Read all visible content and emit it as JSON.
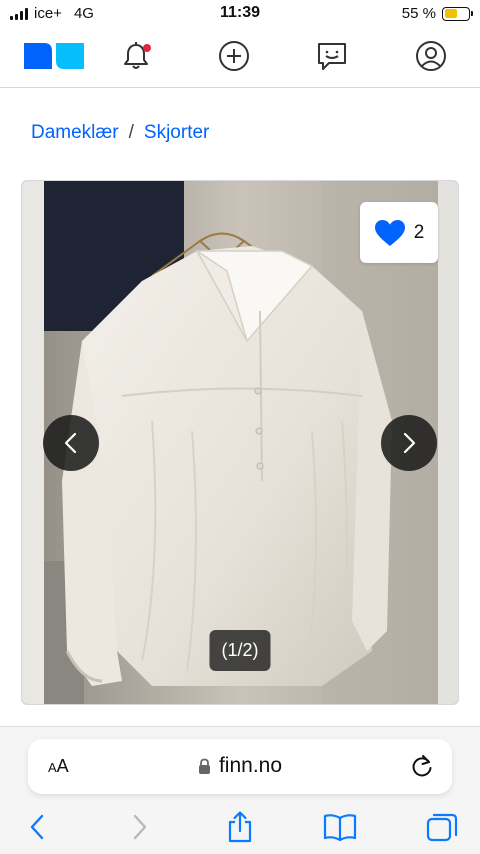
{
  "status": {
    "carrier": "ice+",
    "network": "4G",
    "time": "11:39",
    "battery_label": "55 %",
    "battery_level": 0.55
  },
  "header": {
    "logo": "finn-logo",
    "icons": [
      "bell-icon",
      "plus-circle-icon",
      "chat-icon",
      "profile-icon"
    ],
    "notification_dot_color": "#e0263a"
  },
  "breadcrumb": {
    "items": [
      "Dameklær",
      "Skjorter"
    ],
    "separator": "/"
  },
  "gallery": {
    "favorite_count": "2",
    "image_counter": "(1/2)",
    "heart_color": "#0063fb"
  },
  "browser": {
    "text_size_small": "A",
    "text_size_large": "A",
    "url": "finn.no"
  },
  "colors": {
    "brand_blue": "#0063fb",
    "logo_dark": "#0063fb",
    "logo_light": "#06befb"
  }
}
